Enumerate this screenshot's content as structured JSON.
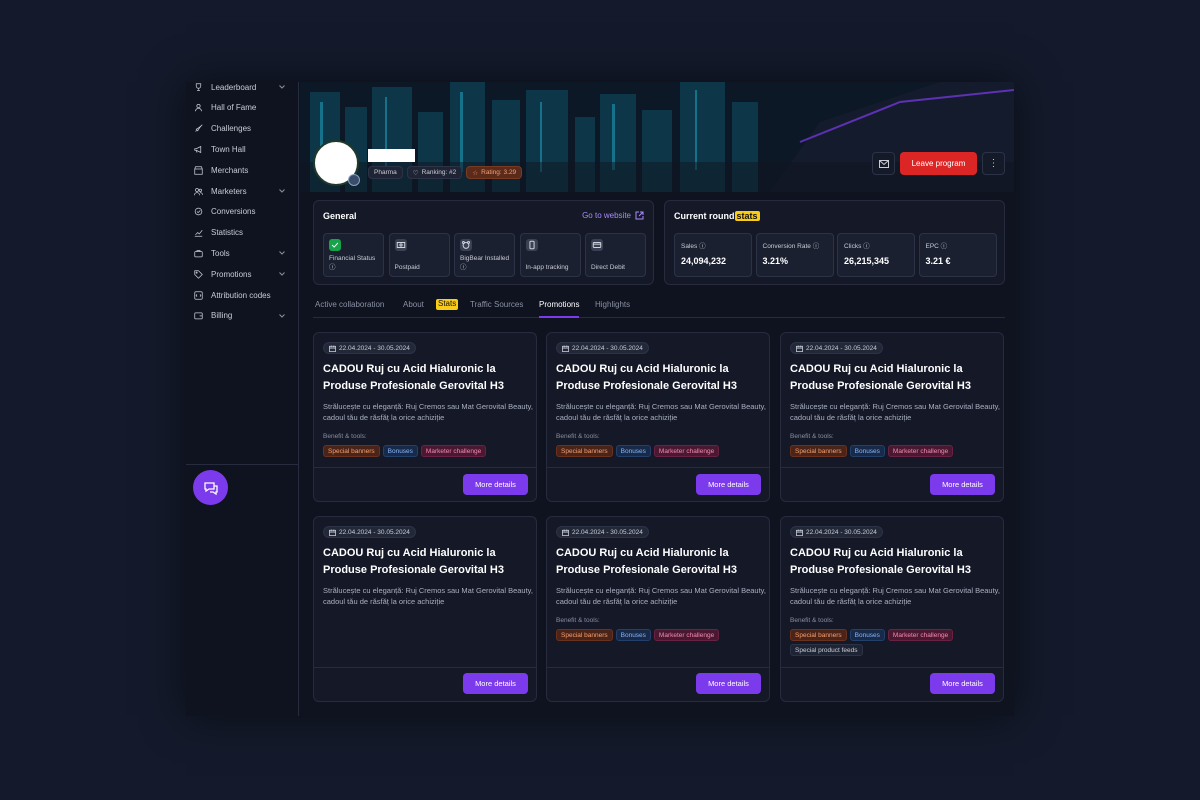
{
  "sidebar": {
    "items": [
      {
        "label": "Leaderboard",
        "icon": "trophy-icon",
        "chevron": true
      },
      {
        "label": "Hall of Fame",
        "icon": "user-icon",
        "chevron": false
      },
      {
        "label": "Challenges",
        "icon": "rocket-icon",
        "chevron": false
      },
      {
        "label": "Town Hall",
        "icon": "megaphone-icon",
        "chevron": false
      },
      {
        "label": "Merchants",
        "icon": "store-icon",
        "chevron": false
      },
      {
        "label": "Marketers",
        "icon": "users-icon",
        "chevron": true
      },
      {
        "label": "Conversions",
        "icon": "conversion-icon",
        "chevron": false
      },
      {
        "label": "Statistics",
        "icon": "chart-icon",
        "chevron": false
      },
      {
        "label": "Tools",
        "icon": "briefcase-icon",
        "chevron": true
      },
      {
        "label": "Promotions",
        "icon": "tag-icon",
        "chevron": true
      },
      {
        "label": "Attribution codes",
        "icon": "code-icon",
        "chevron": false
      },
      {
        "label": "Billing",
        "icon": "wallet-icon",
        "chevron": true
      }
    ]
  },
  "header": {
    "chips": {
      "category": "Pharma",
      "ranking": "Ranking: #2",
      "rating": "Rating: 3.29"
    },
    "leave_label": "Leave program",
    "more_label": "⋮"
  },
  "general": {
    "title": "General",
    "website_label": "Go to website",
    "items": [
      {
        "label": "Financial Status ⓘ",
        "icon": "check-icon",
        "ok": true
      },
      {
        "label": "Postpaid",
        "icon": "money-icon",
        "ok": false
      },
      {
        "label": "BigBear Installed ⓘ",
        "icon": "bear-icon",
        "ok": false
      },
      {
        "label": "In-app tracking",
        "icon": "phone-icon",
        "ok": false
      },
      {
        "label": "Direct Debit",
        "icon": "card-icon",
        "ok": false
      }
    ]
  },
  "current_round": {
    "title_prefix": "Current round",
    "title_highlight": "stats",
    "stats": [
      {
        "label": "Sales ⓘ",
        "value": "24,094,232"
      },
      {
        "label": "Conversion Rate ⓘ",
        "value": "3.21%"
      },
      {
        "label": "Clicks ⓘ",
        "value": "26,215,345"
      },
      {
        "label": "EPC ⓘ",
        "value": "3.21 €"
      }
    ]
  },
  "tabs": {
    "items": [
      "Active collaboration",
      "About",
      "Stats",
      "Traffic Sources",
      "Promotions",
      "Highlights"
    ],
    "active": "Promotions"
  },
  "promotions": [
    {
      "date": "22.04.2024 - 30.05.2024",
      "title": "CADOU Ruj cu Acid Hialuronic la Produse Profesionale Gerovital H3",
      "description": "Strălucește cu eleganță: Ruj Cremos sau Mat Gerovital Beauty, cadoul tău de răsfăț la orice achiziție",
      "benefit_label": "Benefit & tools:",
      "tags": [
        "Special banners",
        "Bonuses",
        "Marketer challenge"
      ],
      "button": "More details"
    },
    {
      "date": "22.04.2024 - 30.05.2024",
      "title": "CADOU Ruj cu Acid Hialuronic la Produse Profesionale Gerovital H3",
      "description": "Strălucește cu eleganță: Ruj Cremos sau Mat Gerovital Beauty, cadoul tău de răsfăț la orice achiziție",
      "benefit_label": "Benefit & tools:",
      "tags": [
        "Special banners",
        "Bonuses",
        "Marketer challenge"
      ],
      "button": "More details"
    },
    {
      "date": "22.04.2024 - 30.05.2024",
      "title": "CADOU Ruj cu Acid Hialuronic la Produse Profesionale Gerovital H3",
      "description": "Strălucește cu eleganță: Ruj Cremos sau Mat Gerovital Beauty, cadoul tău de răsfăț la orice achiziție",
      "benefit_label": "Benefit & tools:",
      "tags": [
        "Special banners",
        "Bonuses",
        "Marketer challenge"
      ],
      "button": "More details"
    },
    {
      "date": "22.04.2024 - 30.05.2024",
      "title": "CADOU Ruj cu Acid Hialuronic la Produse Profesionale Gerovital H3",
      "description": "Strălucește cu eleganță: Ruj Cremos sau Mat Gerovital Beauty, cadoul tău de răsfăț la orice achiziție",
      "benefit_label": "",
      "tags": [],
      "button": "More details"
    },
    {
      "date": "22.04.2024 - 30.05.2024",
      "title": "CADOU Ruj cu Acid Hialuronic la Produse Profesionale Gerovital H3",
      "description": "Strălucește cu eleganță: Ruj Cremos sau Mat Gerovital Beauty, cadoul tău de răsfăț la orice achiziție",
      "benefit_label": "Benefit & tools:",
      "tags": [
        "Special banners",
        "Bonuses",
        "Marketer challenge"
      ],
      "button": "More details"
    },
    {
      "date": "22.04.2024 - 30.05.2024",
      "title": "CADOU Ruj cu Acid Hialuronic la Produse Profesionale Gerovital H3",
      "description": "Strălucește cu eleganță: Ruj Cremos sau Mat Gerovital Beauty, cadoul tău de răsfăț la orice achiziție",
      "benefit_label": "Benefit & tools:",
      "tags": [
        "Special banners",
        "Bonuses",
        "Marketer challenge",
        "Special product feeds"
      ],
      "button": "More details"
    }
  ],
  "colors": {
    "accent": "#7c3aed",
    "danger": "#dc2626",
    "highlight": "#facc15",
    "background": "#0f1320"
  }
}
